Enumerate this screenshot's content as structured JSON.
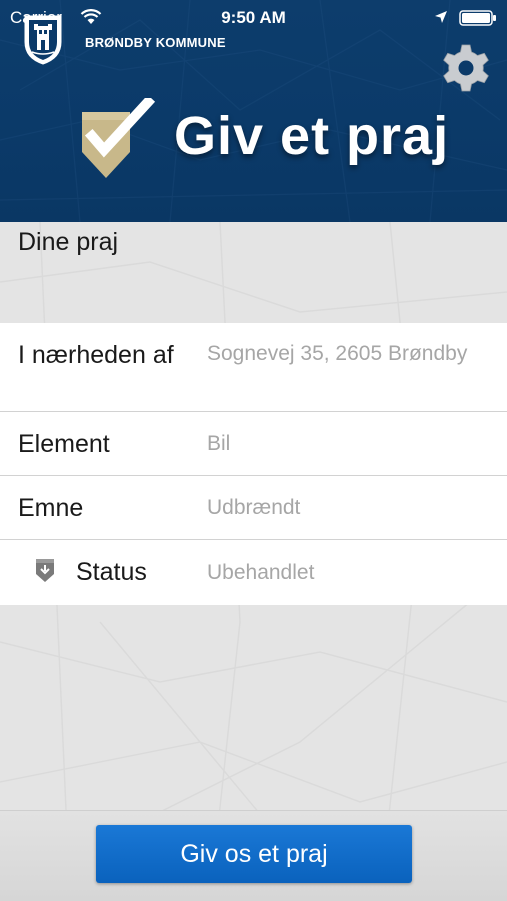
{
  "status_bar": {
    "carrier": "Carrier",
    "time": "9:50 AM"
  },
  "header": {
    "municipality": "BRØNDBY KOMMUNE",
    "app_title": "Giv et praj"
  },
  "section": {
    "title": "Dine praj"
  },
  "form": {
    "rows": [
      {
        "label": "I nærheden af",
        "value": "Sognevej 35, 2605 Brøndby"
      },
      {
        "label": "Element",
        "value": "Bil"
      },
      {
        "label": "Emne",
        "value": "Udbrændt"
      },
      {
        "label": "Status",
        "value": "Ubehandlet"
      }
    ]
  },
  "actions": {
    "submit_label": "Giv os et praj"
  },
  "colors": {
    "header_blue": "#0b3a69",
    "accent_gold": "#c8b88a",
    "button_blue": "#0a6cd0"
  },
  "icons": {
    "wifi": "wifi-icon",
    "location": "location-arrow-icon",
    "battery": "battery-icon",
    "crest": "municipality-crest-icon",
    "settings": "gear-icon",
    "logo": "checkmark-badge-icon",
    "status": "map-pin-icon"
  }
}
